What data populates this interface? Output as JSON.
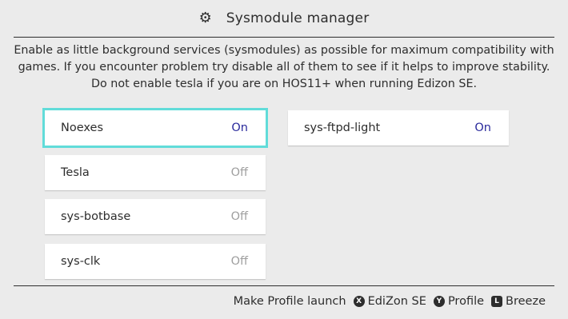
{
  "header": {
    "icon": "gear-icon",
    "title": "Sysmodule manager"
  },
  "description": {
    "line1": "Enable as little background services (sysmodules) as possible for maximum compatibility with",
    "line2": "games. If you encounter problem try disable all of them to see if it helps to improve stability.",
    "line3": "Do not enable tesla if you are on HOS11+ when running Edizon SE."
  },
  "modules_left": [
    {
      "name": "Noexes",
      "status": "On",
      "selected": true
    },
    {
      "name": "Tesla",
      "status": "Off"
    },
    {
      "name": "sys-botbase",
      "status": "Off"
    },
    {
      "name": "sys-clk",
      "status": "Off"
    }
  ],
  "modules_right": [
    {
      "name": "sys-ftpd-light",
      "status": "On"
    }
  ],
  "footer": {
    "make_profile": "Make Profile launch",
    "x_button": "X",
    "x_label": "EdiZon SE",
    "y_button": "Y",
    "y_label": "Profile",
    "l_button": "L",
    "l_label": "Breeze"
  },
  "colors": {
    "background": "#ebebeb",
    "on_status": "#2a2a9c",
    "off_status": "#9f9f9f",
    "selection_outline": "#61dcd9"
  }
}
